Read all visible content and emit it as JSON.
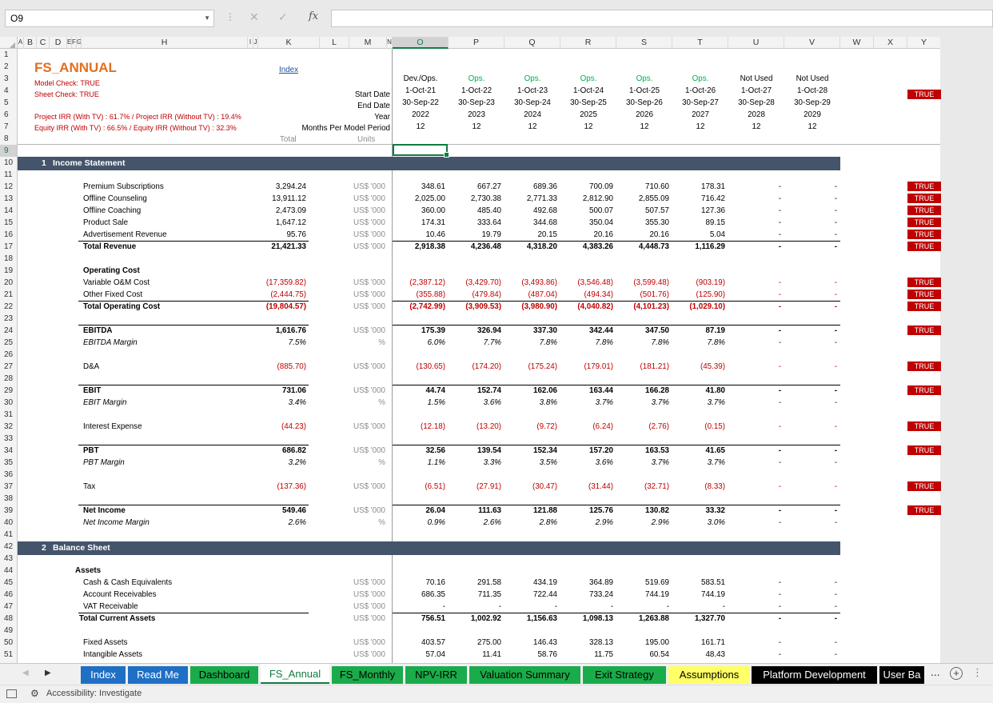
{
  "formula_bar": {
    "name_box": "O9",
    "cancel_icon": "✕",
    "enter_icon": "✓",
    "fx_label": "fx",
    "formula": ""
  },
  "columns": [
    "A",
    "B",
    "C",
    "D",
    "E",
    "F",
    "G",
    "H",
    "I",
    "J",
    "K",
    "L",
    "M",
    "N",
    "O",
    "P",
    "Q",
    "R",
    "S",
    "T",
    "U",
    "V",
    "W",
    "X",
    "Y"
  ],
  "selected_column": "O",
  "selected_row": 9,
  "sheet": {
    "title": "FS_ANNUAL",
    "index_link": "Index",
    "model_check": "Model Check: TRUE",
    "sheet_check": "Sheet Check: TRUE",
    "project_irr": "Project IRR (With TV) : 61.7% / Project IRR (Without TV) : 19.4%",
    "equity_irr": "Equity IRR (With TV) : 66.5% / Equity IRR (Without TV) : 32.3%",
    "total_header": "Total",
    "units_header": "Units",
    "timeline_labels": [
      "Start Date",
      "End Date",
      "Year",
      "Months Per Model Period"
    ],
    "periods": [
      {
        "phase": "Dev./Ops.",
        "start": "1-Oct-21",
        "end": "30-Sep-22",
        "year": "2022",
        "months": "12"
      },
      {
        "phase": "Ops.",
        "start": "1-Oct-22",
        "end": "30-Sep-23",
        "year": "2023",
        "months": "12"
      },
      {
        "phase": "Ops.",
        "start": "1-Oct-23",
        "end": "30-Sep-24",
        "year": "2024",
        "months": "12"
      },
      {
        "phase": "Ops.",
        "start": "1-Oct-24",
        "end": "30-Sep-25",
        "year": "2025",
        "months": "12"
      },
      {
        "phase": "Ops.",
        "start": "1-Oct-25",
        "end": "30-Sep-26",
        "year": "2026",
        "months": "12"
      },
      {
        "phase": "Ops.",
        "start": "1-Oct-26",
        "end": "30-Sep-27",
        "year": "2027",
        "months": "12"
      },
      {
        "phase": "Not Used",
        "start": "1-Oct-27",
        "end": "30-Sep-28",
        "year": "2028",
        "months": "12"
      },
      {
        "phase": "Not Used",
        "start": "1-Oct-28",
        "end": "30-Sep-29",
        "year": "2029",
        "months": "12"
      }
    ],
    "timeline_check": "TRUE",
    "sections": [
      {
        "number": "1",
        "title": "Income Statement"
      },
      {
        "number": "2",
        "title": "Balance Sheet"
      }
    ],
    "rows": [
      {
        "row": 12,
        "label": "Premium Subscriptions",
        "total": "3,294.24",
        "unit": "US$ '000",
        "values": [
          "348.61",
          "667.27",
          "689.36",
          "700.09",
          "710.60",
          "178.31",
          "-",
          "-"
        ],
        "check": "TRUE"
      },
      {
        "row": 13,
        "label": "Offline Counseling",
        "total": "13,911.12",
        "unit": "US$ '000",
        "values": [
          "2,025.00",
          "2,730.38",
          "2,771.33",
          "2,812.90",
          "2,855.09",
          "716.42",
          "-",
          "-"
        ],
        "check": "TRUE"
      },
      {
        "row": 14,
        "label": "Offline Coaching",
        "total": "2,473.09",
        "unit": "US$ '000",
        "values": [
          "360.00",
          "485.40",
          "492.68",
          "500.07",
          "507.57",
          "127.36",
          "-",
          "-"
        ],
        "check": "TRUE"
      },
      {
        "row": 15,
        "label": "Product Sale",
        "total": "1,647.12",
        "unit": "US$ '000",
        "values": [
          "174.31",
          "333.64",
          "344.68",
          "350.04",
          "355.30",
          "89.15",
          "-",
          "-"
        ],
        "check": "TRUE"
      },
      {
        "row": 16,
        "label": "Advertisement Revenue",
        "total": "95.76",
        "unit": "US$ '000",
        "values": [
          "10.46",
          "19.79",
          "20.15",
          "20.16",
          "20.16",
          "5.04",
          "-",
          "-"
        ],
        "check": "TRUE"
      },
      {
        "row": 17,
        "label": "Total Revenue",
        "total": "21,421.33",
        "unit": "US$ '000",
        "values": [
          "2,918.38",
          "4,236.48",
          "4,318.20",
          "4,383.26",
          "4,448.73",
          "1,116.29",
          "-",
          "-"
        ],
        "check": "TRUE",
        "style": "bold",
        "line": "above"
      },
      {
        "row": 19,
        "label": "Operating Cost",
        "style": "bold"
      },
      {
        "row": 20,
        "label": "Variable O&M Cost",
        "total": "(17,359.82)",
        "unit": "US$ '000",
        "values": [
          "(2,387.12)",
          "(3,429.70)",
          "(3,493.86)",
          "(3,546.48)",
          "(3,599.48)",
          "(903.19)",
          "-",
          "-"
        ],
        "check": "TRUE",
        "neg": true
      },
      {
        "row": 21,
        "label": "Other Fixed Cost",
        "total": "(2,444.75)",
        "unit": "US$ '000",
        "values": [
          "(355.88)",
          "(479.84)",
          "(487.04)",
          "(494.34)",
          "(501.76)",
          "(125.90)",
          "-",
          "-"
        ],
        "check": "TRUE",
        "neg": true
      },
      {
        "row": 22,
        "label": "Total Operating Cost",
        "total": "(19,804.57)",
        "unit": "US$ '000",
        "values": [
          "(2,742.99)",
          "(3,909.53)",
          "(3,980.90)",
          "(4,040.82)",
          "(4,101.23)",
          "(1,029.10)",
          "-",
          "-"
        ],
        "check": "TRUE",
        "style": "bold",
        "line": "above",
        "neg": true
      },
      {
        "row": 24,
        "label": "EBITDA",
        "total": "1,616.76",
        "unit": "US$ '000",
        "values": [
          "175.39",
          "326.94",
          "337.30",
          "342.44",
          "347.50",
          "87.19",
          "-",
          "-"
        ],
        "check": "TRUE",
        "style": "bold",
        "line": "above"
      },
      {
        "row": 25,
        "label": "EBITDA Margin",
        "total": "7.5%",
        "unit": "%",
        "values": [
          "6.0%",
          "7.7%",
          "7.8%",
          "7.8%",
          "7.8%",
          "7.8%",
          "-",
          "-"
        ],
        "style": "italic"
      },
      {
        "row": 27,
        "label": "D&A",
        "total": "(885.70)",
        "unit": "US$ '000",
        "values": [
          "(130.65)",
          "(174.20)",
          "(175.24)",
          "(179.01)",
          "(181.21)",
          "(45.39)",
          "-",
          "-"
        ],
        "check": "TRUE",
        "neg": true
      },
      {
        "row": 29,
        "label": "EBIT",
        "total": "731.06",
        "unit": "US$ '000",
        "values": [
          "44.74",
          "152.74",
          "162.06",
          "163.44",
          "166.28",
          "41.80",
          "-",
          "-"
        ],
        "check": "TRUE",
        "style": "bold",
        "line": "above"
      },
      {
        "row": 30,
        "label": "EBIT Margin",
        "total": "3.4%",
        "unit": "%",
        "values": [
          "1.5%",
          "3.6%",
          "3.8%",
          "3.7%",
          "3.7%",
          "3.7%",
          "-",
          "-"
        ],
        "style": "italic"
      },
      {
        "row": 32,
        "label": "Interest Expense",
        "total": "(44.23)",
        "unit": "US$ '000",
        "values": [
          "(12.18)",
          "(13.20)",
          "(9.72)",
          "(6.24)",
          "(2.76)",
          "(0.15)",
          "-",
          "-"
        ],
        "check": "TRUE",
        "neg": true
      },
      {
        "row": 34,
        "label": "PBT",
        "total": "686.82",
        "unit": "US$ '000",
        "values": [
          "32.56",
          "139.54",
          "152.34",
          "157.20",
          "163.53",
          "41.65",
          "-",
          "-"
        ],
        "check": "TRUE",
        "style": "bold",
        "line": "above"
      },
      {
        "row": 35,
        "label": "PBT Margin",
        "total": "3.2%",
        "unit": "%",
        "values": [
          "1.1%",
          "3.3%",
          "3.5%",
          "3.6%",
          "3.7%",
          "3.7%",
          "-",
          "-"
        ],
        "style": "italic"
      },
      {
        "row": 37,
        "label": "Tax",
        "total": "(137.36)",
        "unit": "US$ '000",
        "values": [
          "(6.51)",
          "(27.91)",
          "(30.47)",
          "(31.44)",
          "(32.71)",
          "(8.33)",
          "-",
          "-"
        ],
        "check": "TRUE",
        "neg": true
      },
      {
        "row": 39,
        "label": "Net Income",
        "total": "549.46",
        "unit": "US$ '000",
        "values": [
          "26.04",
          "111.63",
          "121.88",
          "125.76",
          "130.82",
          "33.32",
          "-",
          "-"
        ],
        "check": "TRUE",
        "style": "bold",
        "line": "above"
      },
      {
        "row": 40,
        "label": "Net Income Margin",
        "total": "2.6%",
        "unit": "%",
        "values": [
          "0.9%",
          "2.6%",
          "2.8%",
          "2.9%",
          "2.9%",
          "3.0%",
          "-",
          "-"
        ],
        "style": "italic"
      },
      {
        "row": 44,
        "label": "Assets",
        "style": "bold",
        "indent": "low"
      },
      {
        "row": 45,
        "label": "Cash & Cash Equivalents",
        "unit": "US$ '000",
        "values": [
          "70.16",
          "291.58",
          "434.19",
          "364.89",
          "519.69",
          "583.51",
          "-",
          "-"
        ]
      },
      {
        "row": 46,
        "label": "Account Receivables",
        "unit": "US$ '000",
        "values": [
          "686.35",
          "711.35",
          "722.44",
          "733.24",
          "744.19",
          "744.19",
          "-",
          "-"
        ]
      },
      {
        "row": 47,
        "label": "VAT Receivable",
        "unit": "US$ '000",
        "values": [
          "-",
          "-",
          "-",
          "-",
          "-",
          "-",
          "-",
          "-"
        ]
      },
      {
        "row": 48,
        "label": "Total Current Assets",
        "unit": "US$ '000",
        "values": [
          "756.51",
          "1,002.92",
          "1,156.63",
          "1,098.13",
          "1,263.88",
          "1,327.70",
          "-",
          "-"
        ],
        "style": "bold",
        "line": "above",
        "indent": "mid"
      },
      {
        "row": 50,
        "label": "Fixed Assets",
        "unit": "US$ '000",
        "values": [
          "403.57",
          "275.00",
          "146.43",
          "328.13",
          "195.00",
          "161.71",
          "-",
          "-"
        ]
      },
      {
        "row": 51,
        "label": "Intangible Assets",
        "unit": "US$ '000",
        "values": [
          "57.04",
          "11.41",
          "58.76",
          "11.75",
          "60.54",
          "48.43",
          "-",
          "-"
        ]
      }
    ]
  },
  "tabs": [
    {
      "label": "Index",
      "bg": "#1f6fc5",
      "fg": "#ffffff"
    },
    {
      "label": "Read Me",
      "bg": "#1f6fc5",
      "fg": "#ffffff"
    },
    {
      "label": "Dashboard",
      "bg": "#1aab4a",
      "fg": "#000000"
    },
    {
      "label": "FS_Annual",
      "bg": "#ffffff",
      "fg": "#107c41",
      "active": true
    },
    {
      "label": "FS_Monthly",
      "bg": "#1aab4a",
      "fg": "#000000"
    },
    {
      "label": "NPV-IRR",
      "bg": "#1aab4a",
      "fg": "#000000"
    },
    {
      "label": "Valuation Summary",
      "bg": "#1aab4a",
      "fg": "#000000"
    },
    {
      "label": "Exit Strategy",
      "bg": "#1aab4a",
      "fg": "#000000"
    },
    {
      "label": "Assumptions",
      "bg": "#ffff66",
      "fg": "#000000"
    },
    {
      "label": "Platform Development",
      "bg": "#000000",
      "fg": "#ffffff"
    },
    {
      "label": "User Ba",
      "bg": "#000000",
      "fg": "#ffffff"
    }
  ],
  "tab_overflow": "...",
  "status": {
    "accessibility": "Accessibility: Investigate"
  },
  "colors": {
    "header_bar": "#44546a",
    "check_true": "#c00000",
    "negative": "#c00000",
    "ops_phase": "#00b050",
    "title": "#e07020"
  }
}
